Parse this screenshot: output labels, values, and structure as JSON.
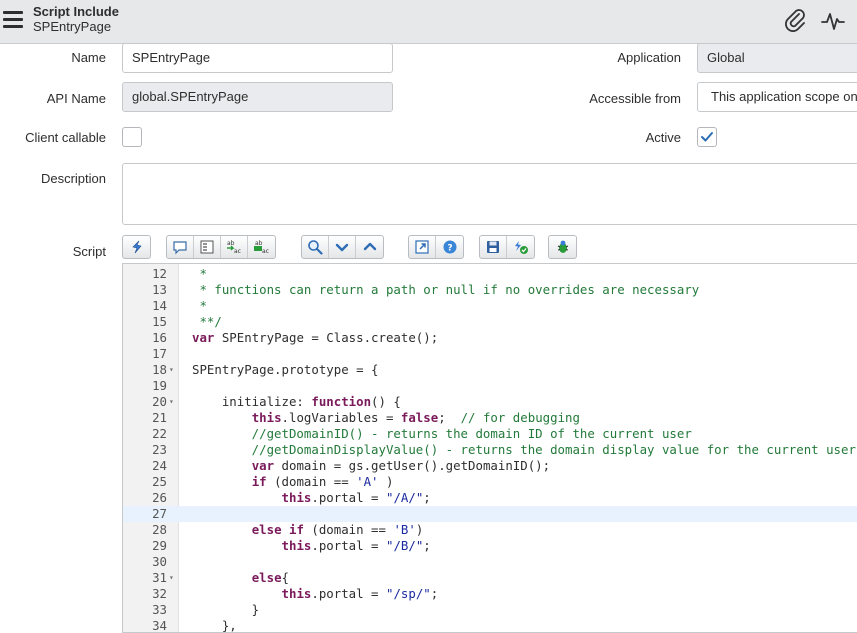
{
  "header": {
    "title": "Script Include",
    "subtitle": "SPEntryPage",
    "icons": [
      "hamburger-menu-icon",
      "paperclip-icon",
      "activity-icon"
    ]
  },
  "form": {
    "name": {
      "label": "Name",
      "value": "SPEntryPage"
    },
    "api_name": {
      "label": "API Name",
      "value": "global.SPEntryPage"
    },
    "client_callable": {
      "label": "Client callable",
      "checked": false
    },
    "application": {
      "label": "Application",
      "value": "Global"
    },
    "accessible_from": {
      "label": "Accessible from",
      "value": "This application scope only"
    },
    "active": {
      "label": "Active",
      "checked": true
    },
    "description": {
      "label": "Description",
      "value": ""
    },
    "script": {
      "label": "Script"
    }
  },
  "toolbar_icons": [
    [
      "format-code-icon"
    ],
    [
      "comment-icon",
      "uncomment-icon",
      "replace-icon",
      "replace-all-icon"
    ],
    [
      "search-icon",
      "find-next-icon",
      "find-previous-icon"
    ],
    [
      "fullscreen-icon",
      "help-icon"
    ],
    [
      "save-icon",
      "syntax-check-icon"
    ],
    [
      "script-debugger-icon"
    ]
  ],
  "code_lines": [
    {
      "num": "12",
      "fold": "",
      "active": false,
      "tokens": [
        {
          "t": " *",
          "c": "comment"
        }
      ]
    },
    {
      "num": "13",
      "fold": "",
      "active": false,
      "tokens": [
        {
          "t": " * functions can return a path or null if no overrides are necessary",
          "c": "comment"
        }
      ]
    },
    {
      "num": "14",
      "fold": "",
      "active": false,
      "tokens": [
        {
          "t": " *",
          "c": "comment"
        }
      ]
    },
    {
      "num": "15",
      "fold": "",
      "active": false,
      "tokens": [
        {
          "t": " **/",
          "c": "comment"
        }
      ]
    },
    {
      "num": "16",
      "fold": "",
      "active": false,
      "tokens": [
        {
          "t": "var",
          "c": "keyword"
        },
        {
          "t": " SPEntryPage = Class.create();",
          "c": "plain"
        }
      ]
    },
    {
      "num": "17",
      "fold": "",
      "active": false,
      "tokens": []
    },
    {
      "num": "18",
      "fold": "▾",
      "active": false,
      "tokens": [
        {
          "t": "SPEntryPage.prototype = {",
          "c": "plain"
        }
      ]
    },
    {
      "num": "19",
      "fold": "",
      "active": false,
      "tokens": []
    },
    {
      "num": "20",
      "fold": "▾",
      "active": false,
      "tokens": [
        {
          "t": "    initialize: ",
          "c": "plain"
        },
        {
          "t": "function",
          "c": "keyword"
        },
        {
          "t": "() {",
          "c": "plain"
        }
      ]
    },
    {
      "num": "21",
      "fold": "",
      "active": false,
      "tokens": [
        {
          "t": "        ",
          "c": "plain"
        },
        {
          "t": "this",
          "c": "keyword"
        },
        {
          "t": ".logVariables = ",
          "c": "plain"
        },
        {
          "t": "false",
          "c": "keyword"
        },
        {
          "t": ";  ",
          "c": "plain"
        },
        {
          "t": "// for debugging",
          "c": "comment"
        }
      ]
    },
    {
      "num": "22",
      "fold": "",
      "active": false,
      "tokens": [
        {
          "t": "        //getDomainID() - returns the domain ID of the current user",
          "c": "comment"
        }
      ]
    },
    {
      "num": "23",
      "fold": "",
      "active": false,
      "tokens": [
        {
          "t": "        //getDomainDisplayValue() - returns the domain display value for the current user",
          "c": "comment"
        }
      ]
    },
    {
      "num": "24",
      "fold": "",
      "active": false,
      "tokens": [
        {
          "t": "        ",
          "c": "plain"
        },
        {
          "t": "var",
          "c": "keyword"
        },
        {
          "t": " domain = gs.getUser().getDomainID();",
          "c": "plain"
        }
      ]
    },
    {
      "num": "25",
      "fold": "",
      "active": false,
      "tokens": [
        {
          "t": "        ",
          "c": "plain"
        },
        {
          "t": "if",
          "c": "keyword"
        },
        {
          "t": " (domain == ",
          "c": "plain"
        },
        {
          "t": "'A'",
          "c": "string"
        },
        {
          "t": " )",
          "c": "plain"
        }
      ]
    },
    {
      "num": "26",
      "fold": "",
      "active": false,
      "tokens": [
        {
          "t": "            ",
          "c": "plain"
        },
        {
          "t": "this",
          "c": "keyword"
        },
        {
          "t": ".portal = ",
          "c": "plain"
        },
        {
          "t": "\"/A/\"",
          "c": "string"
        },
        {
          "t": ";",
          "c": "plain"
        }
      ]
    },
    {
      "num": "27",
      "fold": "",
      "active": true,
      "tokens": []
    },
    {
      "num": "28",
      "fold": "",
      "active": false,
      "tokens": [
        {
          "t": "        ",
          "c": "plain"
        },
        {
          "t": "else if",
          "c": "keyword"
        },
        {
          "t": " (domain == ",
          "c": "plain"
        },
        {
          "t": "'B'",
          "c": "string"
        },
        {
          "t": ")",
          "c": "plain"
        }
      ]
    },
    {
      "num": "29",
      "fold": "",
      "active": false,
      "tokens": [
        {
          "t": "            ",
          "c": "plain"
        },
        {
          "t": "this",
          "c": "keyword"
        },
        {
          "t": ".portal = ",
          "c": "plain"
        },
        {
          "t": "\"/B/\"",
          "c": "string"
        },
        {
          "t": ";",
          "c": "plain"
        }
      ]
    },
    {
      "num": "30",
      "fold": "",
      "active": false,
      "tokens": []
    },
    {
      "num": "31",
      "fold": "▾",
      "active": false,
      "tokens": [
        {
          "t": "        ",
          "c": "plain"
        },
        {
          "t": "else",
          "c": "keyword"
        },
        {
          "t": "{",
          "c": "plain"
        }
      ]
    },
    {
      "num": "32",
      "fold": "",
      "active": false,
      "tokens": [
        {
          "t": "            ",
          "c": "plain"
        },
        {
          "t": "this",
          "c": "keyword"
        },
        {
          "t": ".portal = ",
          "c": "plain"
        },
        {
          "t": "\"/sp/\"",
          "c": "string"
        },
        {
          "t": ";",
          "c": "plain"
        }
      ]
    },
    {
      "num": "33",
      "fold": "",
      "active": false,
      "tokens": [
        {
          "t": "        }",
          "c": "plain"
        }
      ]
    },
    {
      "num": "34",
      "fold": "",
      "active": false,
      "tokens": [
        {
          "t": "    },",
          "c": "plain"
        }
      ]
    }
  ]
}
